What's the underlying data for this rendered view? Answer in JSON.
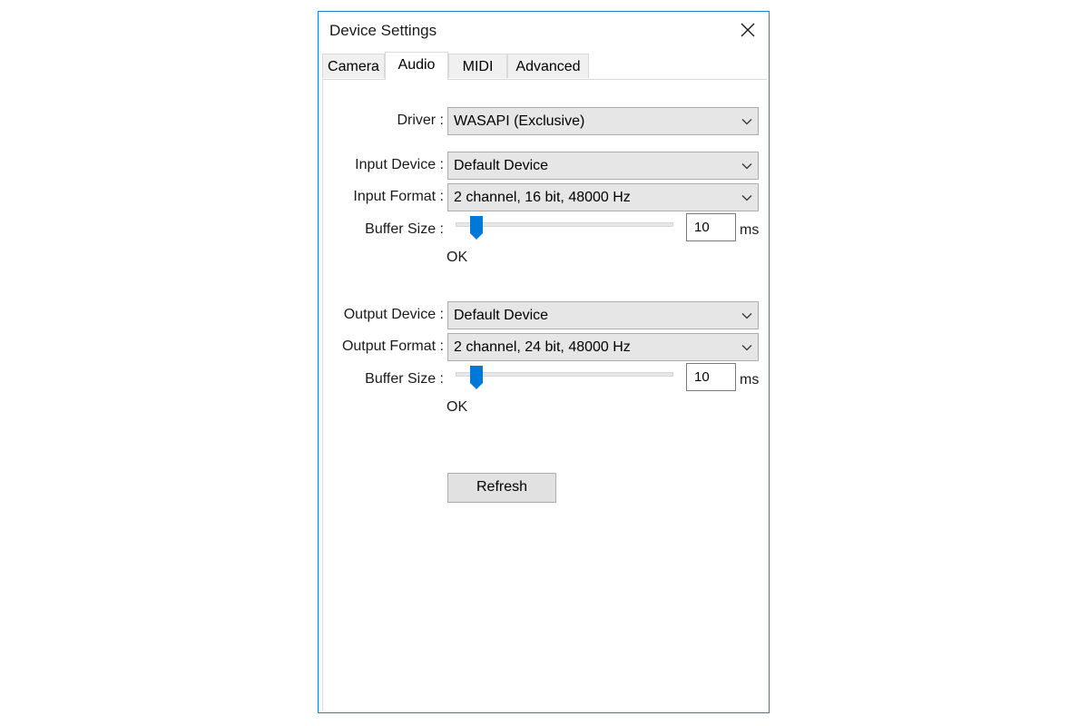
{
  "window": {
    "title": "Device Settings",
    "close_icon": "close-icon"
  },
  "tabs": [
    {
      "label": "Camera",
      "active": false
    },
    {
      "label": "Audio",
      "active": true
    },
    {
      "label": "MIDI",
      "active": false
    },
    {
      "label": "Advanced",
      "active": false
    }
  ],
  "audio": {
    "driver": {
      "label": "Driver :",
      "value": "WASAPI (Exclusive)"
    },
    "input": {
      "device": {
        "label": "Input Device :",
        "value": "Default Device"
      },
      "format": {
        "label": "Input Format :",
        "value": "2 channel, 16 bit, 48000 Hz"
      },
      "buffer": {
        "label": "Buffer Size :",
        "value": "10",
        "unit": "ms",
        "status": "OK"
      }
    },
    "output": {
      "device": {
        "label": "Output Device :",
        "value": "Default Device"
      },
      "format": {
        "label": "Output Format :",
        "value": "2 channel, 24 bit, 48000 Hz"
      },
      "buffer": {
        "label": "Buffer Size :",
        "value": "10",
        "unit": "ms",
        "status": "OK"
      }
    },
    "refresh_label": "Refresh"
  },
  "colors": {
    "accent": "#1883d7",
    "window_border": "#1883d7"
  },
  "icons": {
    "dropdown": "chevron-down-icon",
    "slider_thumb": "slider-thumb"
  }
}
